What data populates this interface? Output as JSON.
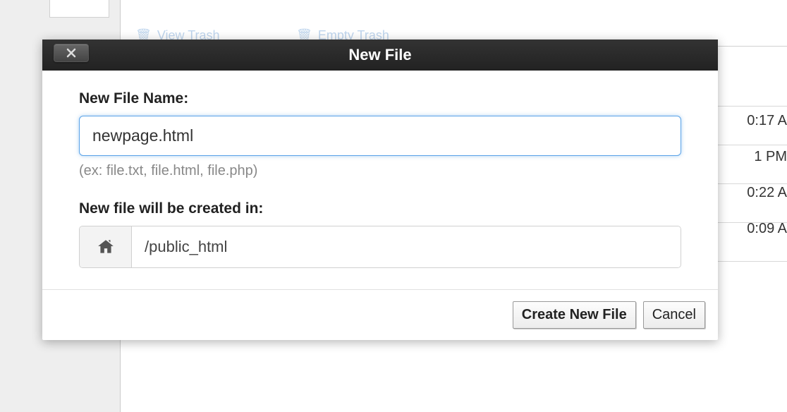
{
  "dialog": {
    "title": "New File",
    "filename_label": "New File Name:",
    "filename_value": "newpage.html",
    "filename_hint": "(ex: file.txt, file.html, file.php)",
    "path_label": "New file will be created in:",
    "path_value": "/public_html",
    "create_button": "Create New File",
    "cancel_button": "Cancel"
  },
  "background": {
    "view_trash": "View Trash",
    "empty_trash": "Empty Trash",
    "timestamps": [
      "0:17 A",
      "1 PM",
      "0:22 A",
      "0:09 A"
    ]
  }
}
